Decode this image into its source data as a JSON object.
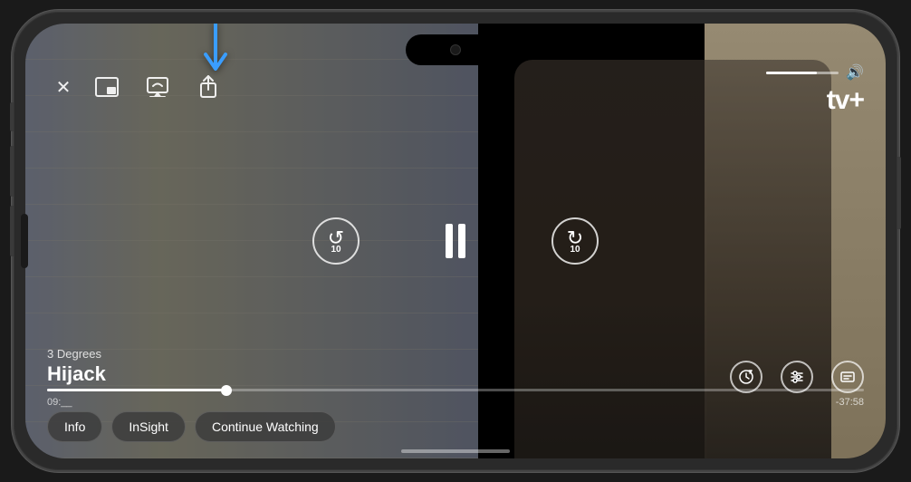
{
  "phone": {
    "dynamic_island": true
  },
  "header": {
    "close_label": "✕",
    "arrow_color": "#3a9dff"
  },
  "top_controls": {
    "close": "✕",
    "icon_pip": "⊡",
    "icon_airplay": "⬛",
    "icon_share": "⬆"
  },
  "appletv": {
    "logo_text": "tv+",
    "apple_char": ""
  },
  "volume": {
    "fill_percent": 70,
    "icon": "🔊"
  },
  "playback": {
    "skip_back_seconds": "10",
    "skip_forward_seconds": "10",
    "is_playing": false
  },
  "title": {
    "episode": "3 Degrees",
    "show": "Hijack"
  },
  "progress": {
    "current_time": "09:__",
    "remaining_time": "-37:58",
    "fill_percent": 22
  },
  "right_controls": {
    "playback_speed": "⏱",
    "audio": "≋",
    "subtitles": "💬"
  },
  "bottom_pills": [
    {
      "label": "Info"
    },
    {
      "label": "InSight"
    },
    {
      "label": "Continue Watching"
    }
  ]
}
